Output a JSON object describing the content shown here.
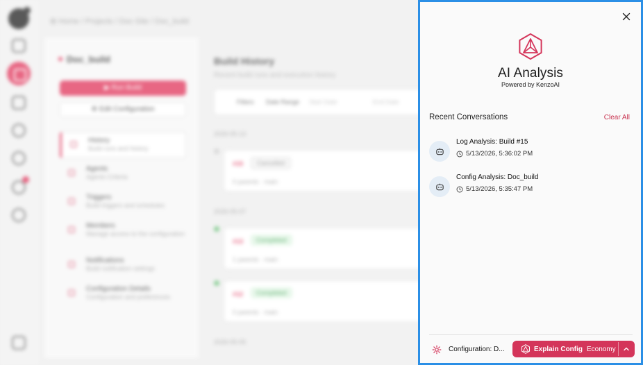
{
  "background": {
    "breadcrumb": "⊞ Home / Projects / Doc-Site / Doc_build",
    "project_title": "Doc_build",
    "run_button": "▶ Run Build",
    "edit_button": "⚙ Edit Configuration",
    "nav_items": [
      {
        "title": "History",
        "subtitle": "Build runs and history"
      },
      {
        "title": "Agents",
        "subtitle": "Agents Criteria"
      },
      {
        "title": "Triggers",
        "subtitle": "Build triggers and schedules"
      },
      {
        "title": "Members",
        "subtitle": "Manage access to the configuration"
      },
      {
        "title": "Notifications",
        "subtitle": "Build notification settings"
      },
      {
        "title": "Configuration Details",
        "subtitle": "Configuration and preferences"
      }
    ],
    "main_title": "Build History",
    "main_subtitle": "Recent build runs and execution history",
    "filters_label": "Filters",
    "date_range_label": "Date Range",
    "start_date_placeholder": "Start Date",
    "end_date_placeholder": "End Date",
    "date_groups": [
      "2026-05-13",
      "2026-05-07",
      "2026-05-05"
    ],
    "builds": [
      {
        "id": "#15",
        "status": "Cancelled",
        "meta": "0 parents  ·  main"
      },
      {
        "id": "#13",
        "status": "Completed",
        "meta": "1 parents  ·  main"
      },
      {
        "id": "#12",
        "status": "Completed",
        "meta": "0 parents  ·  main"
      }
    ]
  },
  "panel": {
    "title": "AI Analysis",
    "subtitle": "Powered by KenzoAI",
    "recent_heading": "Recent Conversations",
    "clear_all": "Clear All",
    "conversations": [
      {
        "title": "Log Analysis: Build #15",
        "timestamp": "5/13/2026, 5:36:02 PM"
      },
      {
        "title": "Config Analysis: Doc_build",
        "timestamp": "5/13/2026, 5:35:47 PM"
      }
    ],
    "context_label": "Configuration: D...",
    "explain_button": "Explain Config",
    "mode": "Economy",
    "accent_color": "#d4355a",
    "border_color": "#2b8fe6"
  }
}
